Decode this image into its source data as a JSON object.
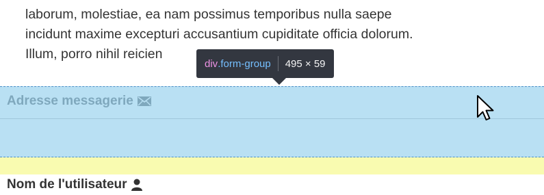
{
  "paragraph": {
    "line1": "laborum, molestiae, ea nam possimus temporibus nulla saepe",
    "line2": "incidunt maxime excepturi accusantium cupiditate officia dolorum.",
    "line3": "Illum, porro nihil reicien"
  },
  "form_group": {
    "email_label": "Adresse messagerie",
    "email_icon": "envelope-icon",
    "email_value": ""
  },
  "username_section": {
    "label": "Nom de l'utilisateur",
    "icon": "user-icon"
  },
  "devtools_tooltip": {
    "tag": "div",
    "class_name": ".form-group",
    "dimensions": "495 × 59"
  },
  "colors": {
    "highlight_content": "#b9e0f3",
    "highlight_margin": "#f9fbb0",
    "highlight_border": "#4a90c8",
    "tooltip_bg": "#333740",
    "tooltip_tag": "#ee93e4",
    "tooltip_class": "#75bfff"
  }
}
